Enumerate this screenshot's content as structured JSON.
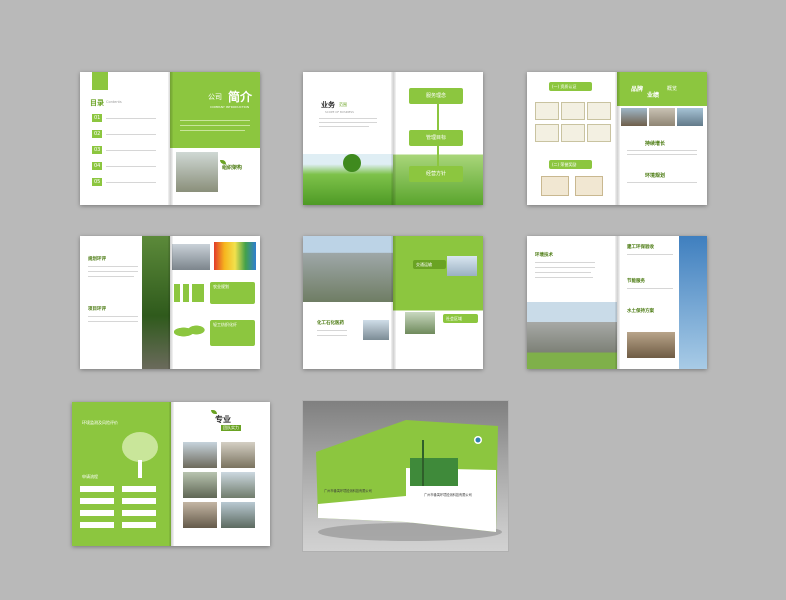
{
  "spread_1": {
    "toc_title": "目录",
    "toc_title_en": "Contents",
    "toc_numbers": [
      "01",
      "02",
      "03",
      "04",
      "05"
    ],
    "intro_title_a": "公司",
    "intro_title_b": "简介",
    "intro_sub_en": "COMPANY INTRODUCTION",
    "section_label": "组织架构"
  },
  "spread_2": {
    "title_a": "业务",
    "title_b": "范围",
    "title_en": "SCOPE OF BUSINESS",
    "boxes": [
      "服务理念",
      "管理目标",
      "经营方针"
    ]
  },
  "spread_3": {
    "tabs": [
      "(一) 资质认证",
      "(二) 荣誉奖励"
    ],
    "title_a": "品牌",
    "title_b": "业绩",
    "title_c": "概览",
    "items": [
      "持续增长",
      "环境规划"
    ]
  },
  "spread_4": {
    "left_items": [
      "规划环评",
      "项目环评"
    ],
    "right_items": [
      "农业规划",
      "轻工纺织化纤"
    ]
  },
  "spread_5": {
    "items": [
      "交通运输",
      "化工石化医药",
      "社会区域"
    ]
  },
  "spread_6": {
    "left_item": "环境技术",
    "right_items": [
      "建工环保验收",
      "节能服务",
      "水土保持方案"
    ]
  },
  "spread_7": {
    "tab_a": "环境监测及风险评价",
    "tab_b": "申请流程",
    "title_a": "专业",
    "title_b": "团队实力"
  },
  "cover": {
    "company_name": "广州市番禺环境检测科技有限公司",
    "company_name_back": "广州市番禺环境检测科技有限公司"
  },
  "colors": {
    "accent": "#8cc63f",
    "dark_accent": "#4a7a10",
    "background": "#b9b9b9"
  }
}
